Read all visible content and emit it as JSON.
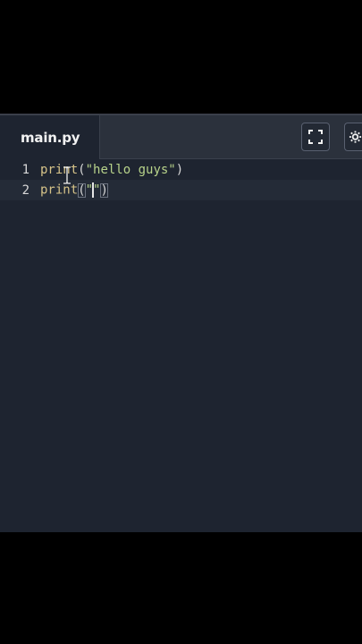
{
  "editor": {
    "tab": {
      "label": "main.py"
    },
    "actions": [
      {
        "name": "fullscreen",
        "icon": "fullscreen-icon"
      },
      {
        "name": "settings",
        "icon": "settings-icon"
      }
    ],
    "lines": [
      {
        "number": "1",
        "fn": "print",
        "open": "(",
        "string": "\"hello guys\"",
        "close": ")"
      },
      {
        "number": "2",
        "fn": "print",
        "open": "(",
        "string_before_caret": "\"",
        "string_after_caret": "\"",
        "close": ")"
      }
    ]
  },
  "colors": {
    "editor_background": "#1e2430",
    "tab_bar_background": "#2b313c",
    "function_color": "#d6c389",
    "string_color": "#b7d28a"
  },
  "cursor": {
    "icon": "text-cursor-icon"
  }
}
